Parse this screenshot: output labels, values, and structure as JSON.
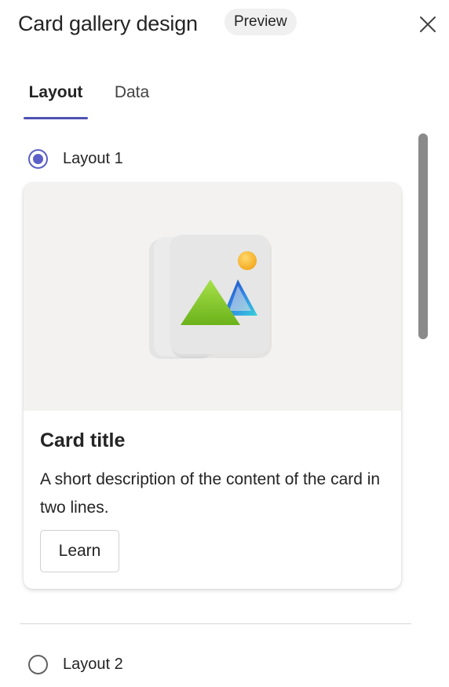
{
  "header": {
    "title": "Card gallery design",
    "badge": "Preview",
    "close_icon": "close-icon"
  },
  "tabs": [
    {
      "label": "Layout",
      "selected": true
    },
    {
      "label": "Data",
      "selected": false
    }
  ],
  "layouts": [
    {
      "label": "Layout 1",
      "selected": true
    },
    {
      "label": "Layout 2",
      "selected": false
    }
  ],
  "card": {
    "image_icon": "image-placeholder-icon",
    "title": "Card title",
    "description": "A short description of the content of the card in two lines.",
    "button_label": "Learn"
  },
  "colors": {
    "accent": "#5b5fc7",
    "tab_indicator": "#4f52b2",
    "image_background": "#f3f2f1"
  }
}
